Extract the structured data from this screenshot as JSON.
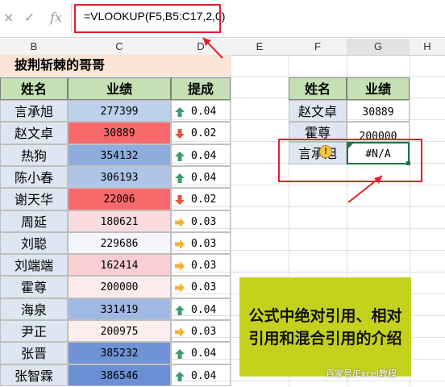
{
  "formula_bar": {
    "cancel_label": "×",
    "enter_label": "✓",
    "fx_label": "fx",
    "formula": "=VLOOKUP(F5,B5:C17,2,0)"
  },
  "columns": [
    "B",
    "C",
    "D",
    "E",
    "F",
    "G",
    "H"
  ],
  "table_title": "披荆斩棘的哥哥",
  "left_headers": [
    "姓名",
    "业绩",
    "提成"
  ],
  "rows": [
    {
      "name": "言承旭",
      "score": "277399",
      "rate": "0.04",
      "dir": "up",
      "bg": "#bdd0ec"
    },
    {
      "name": "赵文卓",
      "score": "30889",
      "rate": "0.02",
      "dir": "down",
      "bg": "#f8696b"
    },
    {
      "name": "热狗",
      "score": "354132",
      "rate": "0.04",
      "dir": "up",
      "bg": "#8eadde"
    },
    {
      "name": "陈小春",
      "score": "306193",
      "rate": "0.04",
      "dir": "up",
      "bg": "#aec5e8"
    },
    {
      "name": "谢天华",
      "score": "22006",
      "rate": "0.02",
      "dir": "down",
      "bg": "#f8696b"
    },
    {
      "name": "周延",
      "score": "180621",
      "rate": "0.03",
      "dir": "right",
      "bg": "#fadbdd"
    },
    {
      "name": "刘聪",
      "score": "229686",
      "rate": "0.03",
      "dir": "right",
      "bg": "#f4f6fb"
    },
    {
      "name": "刘端端",
      "score": "162414",
      "rate": "0.03",
      "dir": "right",
      "bg": "#fbcfd1"
    },
    {
      "name": "霍尊",
      "score": "200000",
      "rate": "0.03",
      "dir": "right",
      "bg": "#fcecee"
    },
    {
      "name": "海泉",
      "score": "331419",
      "rate": "0.04",
      "dir": "up",
      "bg": "#9fb9e4"
    },
    {
      "name": "尹正",
      "score": "200975",
      "rate": "0.03",
      "dir": "right",
      "bg": "#fcedee"
    },
    {
      "name": "张晋",
      "score": "385232",
      "rate": "0.04",
      "dir": "up",
      "bg": "#6f93d6"
    },
    {
      "name": "张智霖",
      "score": "386546",
      "rate": "0.04",
      "dir": "up",
      "bg": "#6a8fd5"
    }
  ],
  "right_headers": [
    "姓名",
    "业绩"
  ],
  "lookup_rows": [
    {
      "name": "赵文卓",
      "value": "30889"
    },
    {
      "name": "霍尊",
      "value": "200000"
    },
    {
      "name": "言承旭",
      "value": "#N/A"
    }
  ],
  "error_badge": "!",
  "callout_text": "公式中绝对引用、相对引用和混合引用的介绍",
  "watermark": "百家号/Excel教程",
  "colors": {
    "accent_red": "#e0202a",
    "header_green": "#c5e0b4",
    "title_peach": "#fbe5d6",
    "callout": "#c4d21e",
    "up_arrow": "#3e9b6f",
    "down_arrow": "#e3573a",
    "right_arrow": "#f3b23b"
  }
}
